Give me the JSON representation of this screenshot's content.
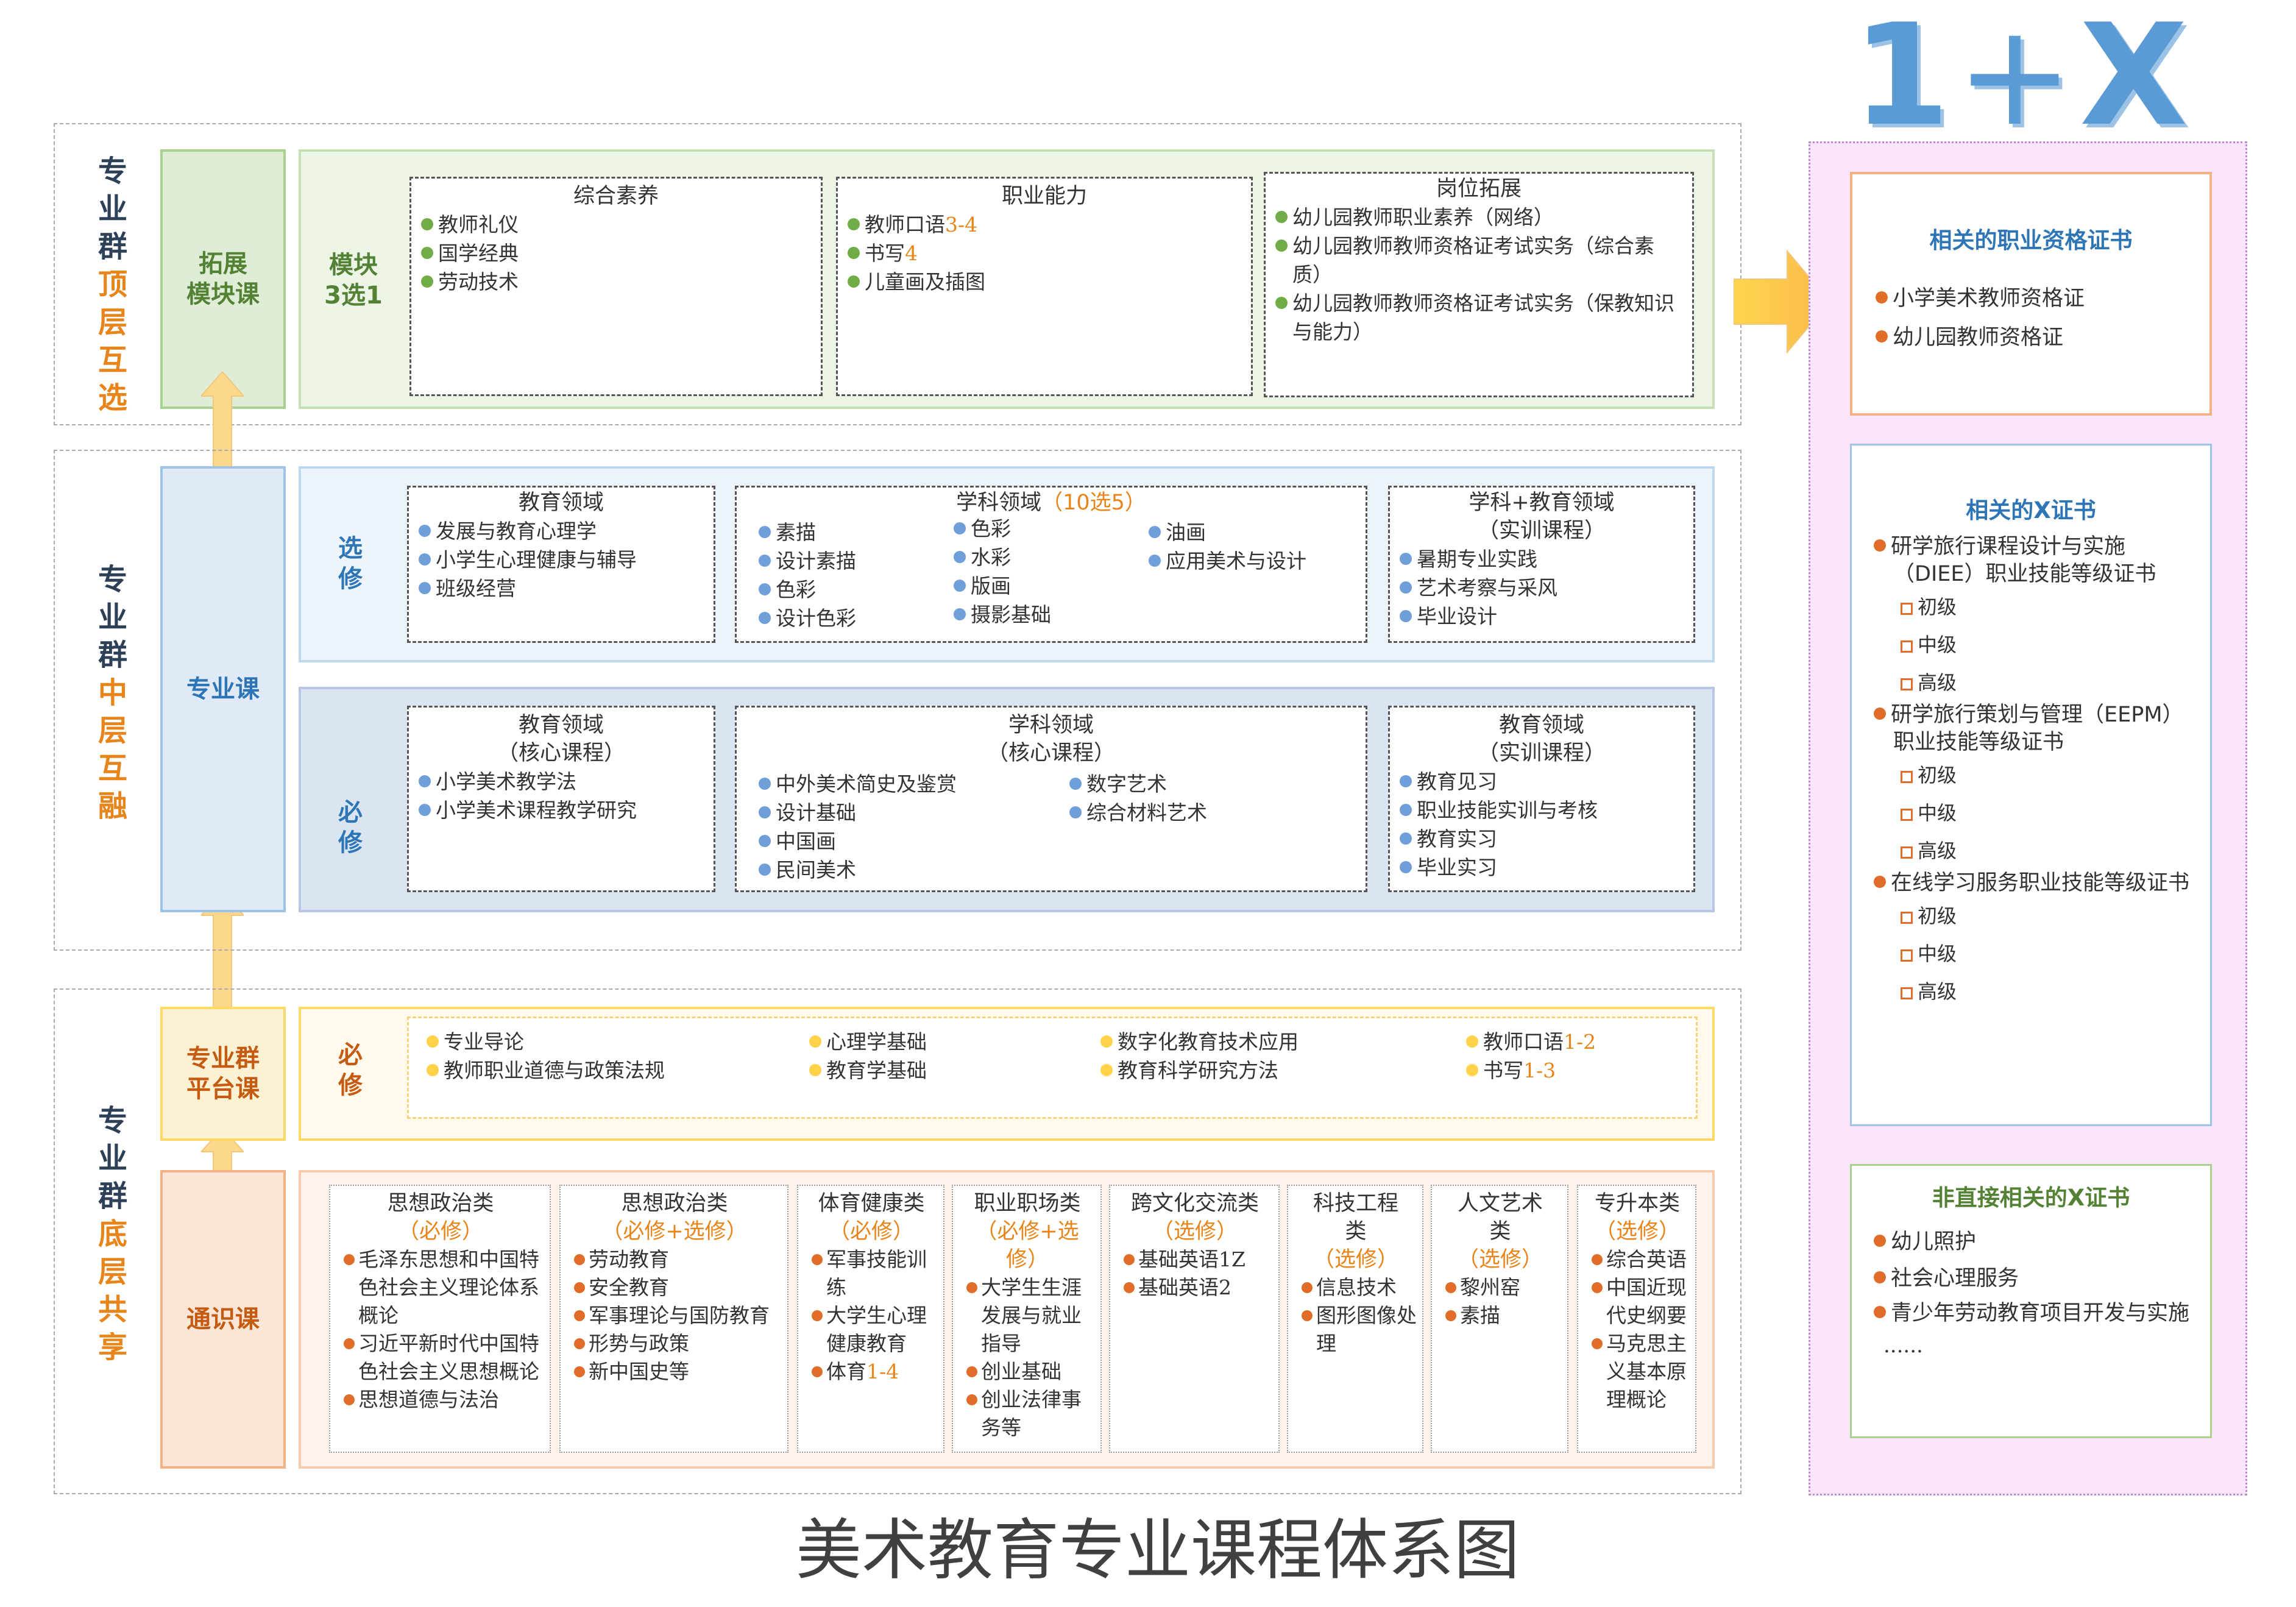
{
  "headline": {
    "one": "1",
    "plus": "+",
    "x": "X"
  },
  "title": "美术教育专业课程体系图",
  "top": {
    "side": [
      "专",
      "业",
      "群",
      "顶",
      "层",
      "互",
      "选"
    ],
    "label": [
      "拓展",
      "模块课"
    ],
    "module": [
      "模块",
      "3选1"
    ],
    "boxes": [
      {
        "title": "综合素养",
        "items": [
          [
            "教师礼仪",
            ""
          ],
          [
            "国学经典",
            ""
          ],
          [
            "劳动技术",
            ""
          ]
        ]
      },
      {
        "title": "职业能力",
        "items": [
          [
            "教师口语",
            "3-4"
          ],
          [
            "书写",
            "4"
          ],
          [
            "儿童画及插图",
            ""
          ]
        ]
      },
      {
        "title": "岗位拓展",
        "items": [
          [
            "幼儿园教师职业素养（网络）",
            ""
          ],
          [
            "幼儿园教师教师资格证考试实务（综合素质）",
            ""
          ],
          [
            "幼儿园教师教师资格证考试实务（保教知识与能力）",
            ""
          ]
        ]
      }
    ]
  },
  "middle": {
    "side": [
      "专",
      "业",
      "群",
      "中",
      "层",
      "互",
      "融"
    ],
    "label": "专业课",
    "elective": {
      "label": [
        "选",
        "修"
      ],
      "box1": {
        "title": "教育领域",
        "items": [
          "发展与教育心理学",
          "小学生心理健康与辅导",
          "班级经营"
        ]
      },
      "box2": {
        "title": "学科领域",
        "note": "（10选5）",
        "col1": [
          "素描",
          "设计素描",
          "色彩",
          "设计色彩"
        ],
        "col2": [
          "色彩",
          "水彩",
          "版画",
          "摄影基础"
        ],
        "col3": [
          "油画",
          "应用美术与设计"
        ]
      },
      "box3": {
        "title": [
          "学科+教育领域",
          "（实训课程）"
        ],
        "items": [
          "暑期专业实践",
          "艺术考察与采风",
          "毕业设计"
        ]
      }
    },
    "required": {
      "label": [
        "必",
        "修"
      ],
      "box1": {
        "title": [
          "教育领域",
          "（核心课程）"
        ],
        "items": [
          "小学美术教学法",
          "小学美术课程教学研究"
        ]
      },
      "box2": {
        "title": [
          "学科领域",
          "（核心课程）"
        ],
        "col1": [
          "中外美术简史及鉴赏",
          "设计基础",
          "中国画",
          "民间美术"
        ],
        "col2": [
          "数字艺术",
          "综合材料艺术"
        ]
      },
      "box3": {
        "title": [
          "教育领域",
          "（实训课程）"
        ],
        "items": [
          "教育见习",
          "职业技能实训与考核",
          "教育实习",
          "毕业实习"
        ]
      }
    }
  },
  "bottom": {
    "side": [
      "专",
      "业",
      "群",
      "底",
      "层",
      "共",
      "享"
    ],
    "platform": {
      "label": [
        "专业群",
        "平台课"
      ],
      "req": [
        "必",
        "修"
      ],
      "cols": [
        [
          [
            "专业导论",
            ""
          ],
          [
            "教师职业道德与政策法规",
            ""
          ]
        ],
        [
          [
            "心理学基础",
            ""
          ],
          [
            "教育学基础",
            ""
          ]
        ],
        [
          [
            "数字化教育技术应用",
            ""
          ],
          [
            "教育科学研究方法",
            ""
          ]
        ],
        [
          [
            "教师口语",
            "1-2"
          ],
          [
            "书写",
            "1-3"
          ]
        ]
      ]
    },
    "general": {
      "label": "通识课",
      "boxes": [
        {
          "title": [
            "思想政治类"
          ],
          "note": [
            "（必修）"
          ],
          "items": [
            [
              "毛泽东思想和中国特色社会主义理论体系概论",
              ""
            ],
            [
              "习近平新时代中国特色社会主义思想概论",
              ""
            ],
            [
              "思想道德与法治",
              ""
            ]
          ]
        },
        {
          "title": [
            "思想政治类"
          ],
          "note": [
            "（必修+选修）"
          ],
          "items": [
            [
              "劳动教育",
              ""
            ],
            [
              "安全教育",
              ""
            ],
            [
              "军事理论与国防教育",
              ""
            ],
            [
              "形势与政策",
              ""
            ],
            [
              "新中国史等",
              ""
            ]
          ]
        },
        {
          "title": [
            "体育健康类"
          ],
          "note": [
            "（必修）"
          ],
          "items": [
            [
              "军事技能训练",
              ""
            ],
            [
              "大学生心理健康教育",
              ""
            ],
            [
              "体育",
              "1-4"
            ]
          ]
        },
        {
          "title": [
            "职业职场类"
          ],
          "note": [
            "（必修+选",
            "修）"
          ],
          "items": [
            [
              "大学生生涯发展与就业指导",
              ""
            ],
            [
              "创业基础",
              ""
            ],
            [
              "创业法律事务等",
              ""
            ]
          ]
        },
        {
          "title": [
            "跨文化交流类"
          ],
          "note": [
            "（选修）"
          ],
          "items": [
            [
              "基础英语1Z",
              ""
            ],
            [
              "基础英语2",
              ""
            ]
          ]
        },
        {
          "title": [
            "科技工程",
            "类"
          ],
          "note": [
            "（选修）"
          ],
          "items": [
            [
              "信息技术",
              ""
            ],
            [
              "图形图像处理",
              ""
            ]
          ]
        },
        {
          "title": [
            "人文艺术",
            "类"
          ],
          "note": [
            "（选修）"
          ],
          "items": [
            [
              "黎州窑",
              ""
            ],
            [
              "素描",
              ""
            ]
          ]
        },
        {
          "title": [
            "专升本类"
          ],
          "note": [
            "（选修）"
          ],
          "items": [
            [
              "综合英语",
              ""
            ],
            [
              "中国近现代史纲要",
              ""
            ],
            [
              "马克思主义基本原理概论",
              ""
            ]
          ]
        }
      ]
    }
  },
  "right": {
    "cert": {
      "title": "相关的职业资格证书",
      "items": [
        "小学美术教师资格证",
        "幼儿园教师资格证"
      ]
    },
    "x": {
      "title": "相关的X证书",
      "groups": [
        {
          "name": "研学旅行课程设计与实施（DIEE）职业技能等级证书",
          "levels": [
            "初级",
            "中级",
            "高级"
          ]
        },
        {
          "name": "研学旅行策划与管理（EEPM）职业技能等级证书",
          "levels": [
            "初级",
            "中级",
            "高级"
          ]
        },
        {
          "name": "在线学习服务职业技能等级证书",
          "levels": [
            "初级",
            "中级",
            "高级"
          ]
        }
      ]
    },
    "indirect": {
      "title": "非直接相关的X证书",
      "items": [
        "幼儿照护",
        "社会心理服务",
        "青少年劳动教育项目开发与实施"
      ],
      "more": "......"
    }
  }
}
